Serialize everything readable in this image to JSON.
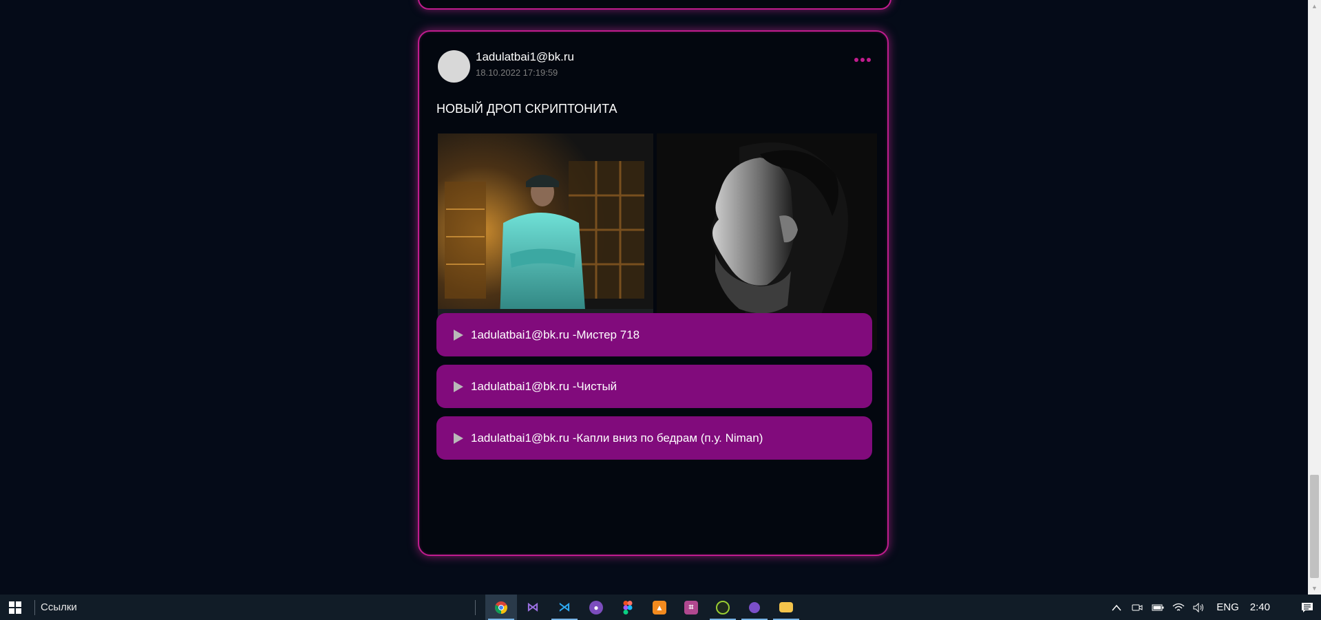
{
  "post": {
    "author": "1adulatbai1@bk.ru",
    "timestamp": "18.10.2022 17:19:59",
    "title": "НОВЫЙ ДРОП СКРИПТОНИТА",
    "tracks": [
      {
        "label": "1adulatbai1@bk.ru -Мистер 718"
      },
      {
        "label": "1adulatbai1@bk.ru -Чистый"
      },
      {
        "label": "1adulatbai1@bk.ru -Капли вниз по бедрам (п.у. Niman)"
      }
    ]
  },
  "colors": {
    "background": "#050b18",
    "card_border": "#c01c8e",
    "track_bg": "#810b7c",
    "avatar": "#d8d8d8"
  },
  "taskbar": {
    "links_label": "Ссылки",
    "apps": [
      "chrome-icon",
      "visual-studio-icon",
      "vscode-icon",
      "github-desktop-icon",
      "figma-icon",
      "sublime-merge-icon",
      "jetbrains-icon",
      "xampp-icon",
      "tor-icon",
      "file-explorer-icon"
    ],
    "language": "ENG",
    "clock": "2:40"
  }
}
